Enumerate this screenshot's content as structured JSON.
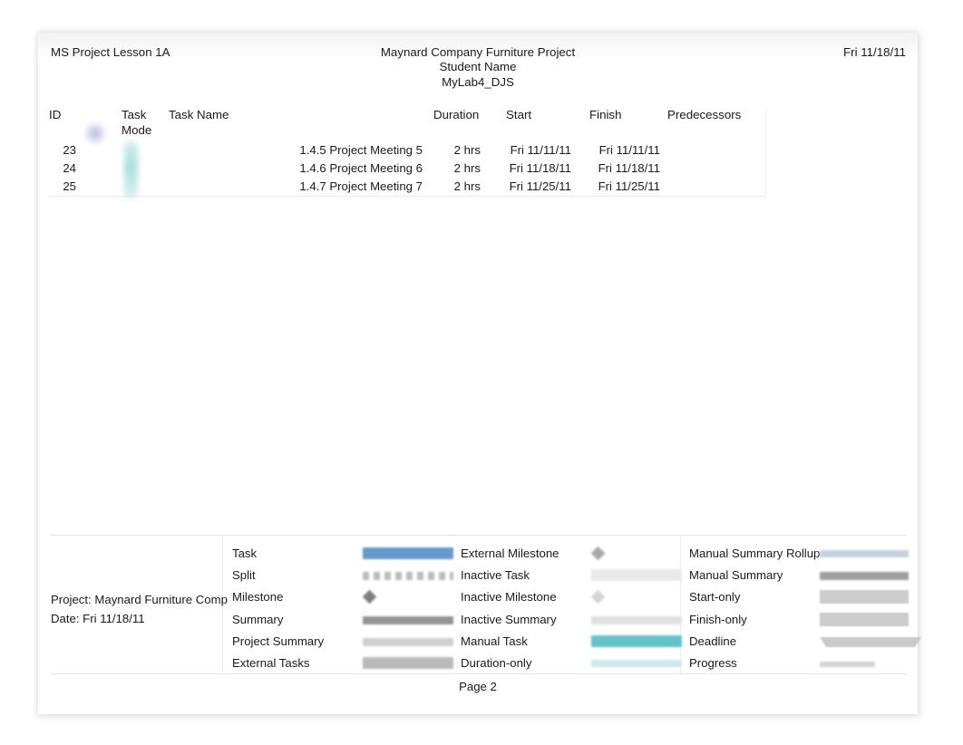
{
  "header": {
    "left": "MS Project Lesson 1A",
    "center_lines": [
      "Maynard Company Furniture Project",
      "Student Name",
      "MyLab4_DJS"
    ],
    "right": "Fri 11/18/11"
  },
  "table": {
    "columns": {
      "id": "ID",
      "task_mode": "Task\nMode",
      "task_name": "Task Name",
      "duration": "Duration",
      "start": "Start",
      "finish": "Finish",
      "predecessors": "Predecessors"
    },
    "rows": [
      {
        "id": "23",
        "task_mode_icon": "manual-schedule-icon",
        "task_name": "1.4.5 Project Meeting 5",
        "duration": "2 hrs",
        "start": "Fri 11/11/11",
        "finish": "Fri 11/11/11",
        "predecessors": ""
      },
      {
        "id": "24",
        "task_mode_icon": "manual-schedule-icon",
        "task_name": "1.4.6 Project Meeting 6",
        "duration": "2 hrs",
        "start": "Fri 11/18/11",
        "finish": "Fri 11/18/11",
        "predecessors": ""
      },
      {
        "id": "25",
        "task_mode_icon": "manual-schedule-icon",
        "task_name": "1.4.7 Project Meeting 7",
        "duration": "2 hrs",
        "start": "Fri 11/25/11",
        "finish": "Fri 11/25/11",
        "predecessors": ""
      }
    ]
  },
  "legend": {
    "project_line": "Project: Maynard Furniture Comp",
    "date_line": "Date: Fri 11/18/11",
    "column_a": [
      {
        "label": "Task",
        "swatch": "bar",
        "color": "#6699cc"
      },
      {
        "label": "Split",
        "swatch": "split",
        "color": "#bcbcbc"
      },
      {
        "label": "Milestone",
        "swatch": "diamond",
        "color": "#7f7f7f"
      },
      {
        "label": "Summary",
        "swatch": "summary",
        "color": "#949494"
      },
      {
        "label": "Project Summary",
        "swatch": "summary",
        "color": "#cfcfcf"
      },
      {
        "label": "External Tasks",
        "swatch": "bar",
        "color": "#b9b9b9"
      }
    ],
    "column_b": [
      {
        "label": "External Milestone",
        "swatch": "diamond",
        "color": "#a8a8a8"
      },
      {
        "label": "Inactive Task",
        "swatch": "bar",
        "color": "#e9e9e9"
      },
      {
        "label": "Inactive Milestone",
        "swatch": "diamond",
        "color": "#d6d6d6"
      },
      {
        "label": "Inactive Summary",
        "swatch": "summary",
        "color": "#e0e0e0"
      },
      {
        "label": "Manual Task",
        "swatch": "bar",
        "color": "#62c3cc"
      },
      {
        "label": "Duration-only",
        "swatch": "thinbar",
        "color": "#cfe9ea"
      }
    ],
    "column_c": [
      {
        "label": "Manual Summary Rollup",
        "swatch": "thinbar",
        "color": "#c3d2de"
      },
      {
        "label": "Manual Summary",
        "swatch": "summary",
        "color": "#a0a0a0"
      },
      {
        "label": "Start-only",
        "swatch": "pipe",
        "color": "#cccccc"
      },
      {
        "label": "Finish-only",
        "swatch": "pipe",
        "color": "#cccccc"
      },
      {
        "label": "Deadline",
        "swatch": "arrowdown",
        "color": "#c9c9c9"
      },
      {
        "label": "Progress",
        "swatch": "progress",
        "color": "#d4d4d4"
      }
    ]
  },
  "footer": {
    "page_label": "Page 2"
  }
}
